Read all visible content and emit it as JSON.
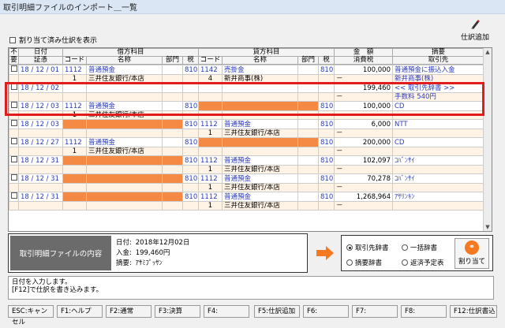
{
  "window_title": "取引明細ファイルのインポート＿一覧",
  "unassigned_label": "割り当て済み仕訳を表示",
  "add_entry_label": "仕訳追加",
  "headers": {
    "top": {
      "fuyo": "不",
      "date": "日付",
      "debit": "借方科目",
      "credit": "貸方科目",
      "amount": "金　額",
      "summary": "摘要"
    },
    "sub": {
      "fuyo": "要",
      "voucher": "証憑",
      "code": "コード",
      "name": "名称",
      "dept": "部門",
      "tax": "税",
      "ccode": "コード",
      "cname": "名称",
      "cdept": "部門",
      "ctax": "税",
      "tax_amount": "消費税",
      "partner": "取引先"
    }
  },
  "rows": [
    {
      "date": "18 / 12 / 01",
      "dcode": "1112",
      "dname": "普通預金",
      "dtax": "810",
      "ccode": "1142",
      "cname": "売掛金",
      "ctax": "810",
      "amount": "100,000",
      "summary": "普通預金に振込入金",
      "sub_code": "1",
      "sub_name": "三井住友銀行/本店",
      "sub_cname": "新井商事(株)",
      "sub_ccode": "4",
      "sub_partner": "新井商事(株)",
      "sub_dash": "－"
    },
    {
      "date": "18 / 12 / ",
      "date_day": "02",
      "amount": "199,460",
      "summary": "<< 取引先辞書 >>",
      "sub_dash": "－",
      "sub_partner": "手数料 540円"
    },
    {
      "date": "18 / 12 / 03",
      "dcode": "1112",
      "dname": "普通預金",
      "dtax": "810",
      "ctax": "810",
      "amount": "100,000",
      "summary": "CD",
      "sub_code": "1",
      "sub_name": "三井住友銀行/本店",
      "sub_dash": "－"
    },
    {
      "date": "18 / 12 / 03",
      "dtax": "810",
      "ccode": "1112",
      "cname": "普通預金",
      "ctax": "810",
      "amount": "6,000",
      "summary": "NTT",
      "sub_ccode": "1",
      "sub_cname": "三井住友銀行/本店",
      "sub_dash": "－"
    },
    {
      "date": "18 / 12 / 27",
      "dcode": "1112",
      "dname": "普通預金",
      "dtax": "810",
      "ctax": "810",
      "amount": "200,000",
      "summary": "CD",
      "sub_code": "1",
      "sub_name": "三井住友銀行/本店",
      "sub_dash": "－"
    },
    {
      "date": "18 / 12 / 31",
      "dtax": "810",
      "ccode": "1112",
      "cname": "普通預金",
      "ctax": "810",
      "amount": "102,097",
      "summary": "ｺﾊﾞﾝｻｲ",
      "sub_ccode": "1",
      "sub_cname": "三井住友銀行/本店",
      "sub_dash": "－"
    },
    {
      "date": "18 / 12 / 31",
      "dtax": "810",
      "ccode": "1112",
      "cname": "普通預金",
      "ctax": "810",
      "amount": "70,278",
      "summary": "ｺﾊﾞﾝｻｲ",
      "sub_ccode": "1",
      "sub_cname": "三井住友銀行/本店",
      "sub_dash": "－"
    },
    {
      "date": "18 / 12 / 31",
      "dtax": "810",
      "ccode": "1112",
      "cname": "普通預金",
      "ctax": "810",
      "amount": "1,268,964",
      "summary": "ｱｻﾘﾝｷﾝ",
      "sub_ccode": "1",
      "sub_cname": "三井住友銀行/本店",
      "sub_dash": "－"
    }
  ],
  "info": {
    "label": "取引明細ファイルの内容",
    "date_key": "日付:",
    "date_val": "2018年12月02日",
    "deposit_key": "入金:",
    "deposit_val": "199,460円",
    "summary_key": "摘要:",
    "summary_val": "ｱｻﾐﾌﾟｯｻﾝ"
  },
  "options": {
    "partner_dict": "取引先辞書",
    "bulk_dict": "一括辞書",
    "summary_dict": "摘要辞書",
    "refund_sched": "返済予定表",
    "assign_btn": "割り当て"
  },
  "message": [
    "日付を入力します。",
    "[F12]で仕訳を書き込みます。"
  ],
  "fkeys": [
    "ESC:キャンセル",
    "F1:ヘルプ",
    "F2:通常",
    "F3:決算",
    "F4:",
    "F5:仕訳追加",
    "F6:",
    "F7:",
    "F8:",
    "F12:仕訳書込"
  ],
  "colors": {
    "accent_orange": "#f58a45",
    "highlight_red": "#e01c1c",
    "link_blue": "#2a3bc0"
  }
}
